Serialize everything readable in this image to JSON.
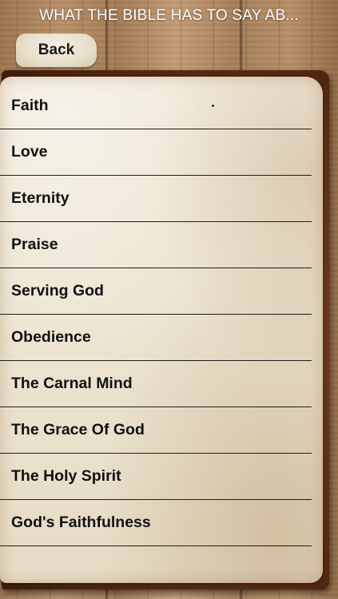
{
  "header": {
    "title": "WHAT THE BIBLE HAS TO SAY AB..."
  },
  "nav": {
    "back_label": "Back"
  },
  "topics": [
    {
      "label": "Faith"
    },
    {
      "label": "Love"
    },
    {
      "label": "Eternity"
    },
    {
      "label": "Praise"
    },
    {
      "label": "Serving God"
    },
    {
      "label": "Obedience"
    },
    {
      "label": "The Carnal Mind"
    },
    {
      "label": "The Grace Of God"
    },
    {
      "label": "The Holy Spirit"
    },
    {
      "label": "God's Faithfulness"
    }
  ],
  "colors": {
    "title_text": "#ffffff",
    "item_text": "#111111",
    "separator": "#1e1e1e",
    "paper": "#ece4d0",
    "board": "#5b2c12",
    "wood": "#a67f58"
  }
}
